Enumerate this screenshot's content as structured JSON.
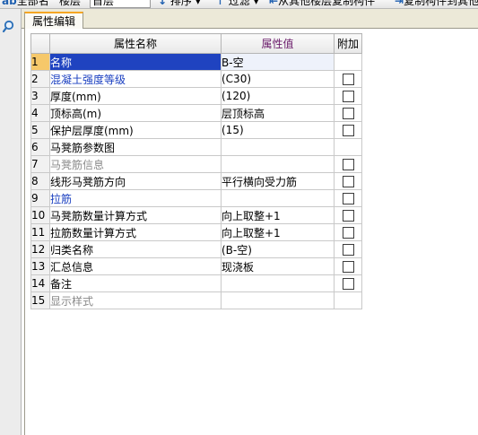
{
  "toolbar": {
    "items": [
      {
        "label": "全部名",
        "icon": "abc-icon"
      },
      {
        "label": "楼层"
      },
      {
        "label": "首层"
      },
      {
        "label": "排序"
      },
      {
        "label": "过滤"
      },
      {
        "label": "从其他楼层复制构件"
      },
      {
        "label": "复制构件到其他楼层"
      }
    ]
  },
  "tab": {
    "label": "属性编辑"
  },
  "table": {
    "headers": {
      "name": "属性名称",
      "value": "属性值",
      "extra": "附加"
    },
    "rows": [
      {
        "num": "1",
        "name": "名称",
        "value": "B-空",
        "style": "selected",
        "checkbox": false
      },
      {
        "num": "2",
        "name": "混凝土强度等级",
        "value": "(C30)",
        "style": "blue",
        "checkbox": true
      },
      {
        "num": "3",
        "name": "厚度(mm)",
        "value": "(120)",
        "style": "normal",
        "checkbox": true
      },
      {
        "num": "4",
        "name": "顶标高(m)",
        "value": "层顶标高",
        "style": "normal",
        "checkbox": true
      },
      {
        "num": "5",
        "name": "保护层厚度(mm)",
        "value": "(15)",
        "style": "normal",
        "checkbox": true
      },
      {
        "num": "6",
        "name": "马凳筋参数图",
        "value": "",
        "style": "normal",
        "checkbox": false
      },
      {
        "num": "7",
        "name": "马凳筋信息",
        "value": "",
        "style": "gray",
        "checkbox": true
      },
      {
        "num": "8",
        "name": "线形马凳筋方向",
        "value": "平行横向受力筋",
        "style": "normal",
        "checkbox": true
      },
      {
        "num": "9",
        "name": "拉筋",
        "value": "",
        "style": "blue",
        "checkbox": true
      },
      {
        "num": "10",
        "name": "马凳筋数量计算方式",
        "value": "向上取整+1",
        "style": "normal",
        "checkbox": true
      },
      {
        "num": "11",
        "name": "拉筋数量计算方式",
        "value": "向上取整+1",
        "style": "normal",
        "checkbox": true
      },
      {
        "num": "12",
        "name": "归类名称",
        "value": "(B-空)",
        "style": "normal",
        "checkbox": true
      },
      {
        "num": "13",
        "name": "汇总信息",
        "value": "现浇板",
        "style": "normal",
        "checkbox": true
      },
      {
        "num": "14",
        "name": "备注",
        "value": "",
        "style": "normal",
        "checkbox": true
      },
      {
        "num": "15",
        "name": "显示样式",
        "value": "",
        "style": "gray",
        "checkbox": false,
        "expandable": true
      }
    ]
  }
}
